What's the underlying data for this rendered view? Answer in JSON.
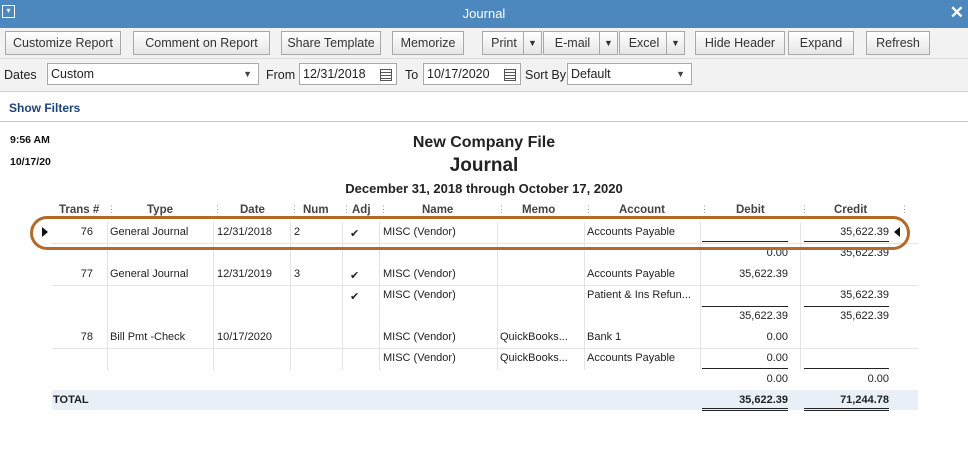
{
  "window": {
    "title": "Journal"
  },
  "toolbar": {
    "customize": "Customize Report",
    "comment": "Comment on Report",
    "share": "Share Template",
    "memorize": "Memorize",
    "print": "Print",
    "email": "E-mail",
    "excel": "Excel",
    "hide_header": "Hide Header",
    "expand": "Expand",
    "refresh": "Refresh"
  },
  "filters": {
    "dates_label": "Dates",
    "dates_value": "Custom",
    "from_label": "From",
    "from_value": "12/31/2018",
    "to_label": "To",
    "to_value": "10/17/2020",
    "sortby_label": "Sort By",
    "sortby_value": "Default",
    "show_filters": "Show Filters"
  },
  "report": {
    "time": "9:56 AM",
    "date": "10/17/20",
    "company": "New Company File",
    "title": "Journal",
    "period": "December 31, 2018 through October 17, 2020",
    "columns": [
      "Trans #",
      "Type",
      "Date",
      "Num",
      "Adj",
      "Name",
      "Memo",
      "Account",
      "Debit",
      "Credit"
    ],
    "rows": [
      {
        "trans": "76",
        "type": "General Journal",
        "date": "12/31/2018",
        "num": "2",
        "adj": "✔",
        "name": "MISC (Vendor)",
        "memo": "",
        "account": "Accounts Payable",
        "debit": "",
        "credit": "35,622.39"
      },
      {
        "trans": "",
        "type": "",
        "date": "",
        "num": "",
        "adj": "",
        "name": "",
        "memo": "",
        "account": "",
        "debit": "0.00",
        "credit": "35,622.39"
      },
      {
        "trans": "77",
        "type": "General Journal",
        "date": "12/31/2019",
        "num": "3",
        "adj": "✔",
        "name": "MISC (Vendor)",
        "memo": "",
        "account": "Accounts Payable",
        "debit": "35,622.39",
        "credit": ""
      },
      {
        "trans": "",
        "type": "",
        "date": "",
        "num": "",
        "adj": "✔",
        "name": "MISC (Vendor)",
        "memo": "",
        "account": "Patient & Ins Refun...",
        "debit": "",
        "credit": "35,622.39"
      },
      {
        "trans": "",
        "type": "",
        "date": "",
        "num": "",
        "adj": "",
        "name": "",
        "memo": "",
        "account": "",
        "debit": "35,622.39",
        "credit": "35,622.39"
      },
      {
        "trans": "78",
        "type": "Bill Pmt -Check",
        "date": "10/17/2020",
        "num": "",
        "adj": "",
        "name": "MISC (Vendor)",
        "memo": "QuickBooks...",
        "account": "Bank 1",
        "debit": "0.00",
        "credit": ""
      },
      {
        "trans": "",
        "type": "",
        "date": "",
        "num": "",
        "adj": "",
        "name": "MISC (Vendor)",
        "memo": "QuickBooks...",
        "account": "Accounts Payable",
        "debit": "0.00",
        "credit": ""
      },
      {
        "trans": "",
        "type": "",
        "date": "",
        "num": "",
        "adj": "",
        "name": "",
        "memo": "",
        "account": "",
        "debit": "0.00",
        "credit": "0.00"
      }
    ],
    "total": {
      "label": "TOTAL",
      "debit": "35,622.39",
      "credit": "71,244.78"
    }
  }
}
